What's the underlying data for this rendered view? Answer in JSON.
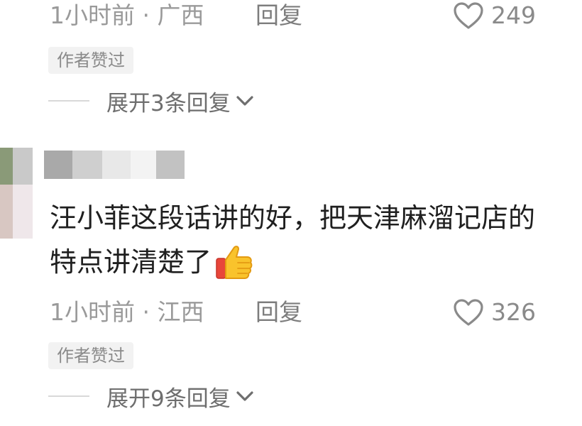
{
  "comment_top": {
    "time": "1小时前 · 广西",
    "reply": "回复",
    "likes": "249",
    "badge": "作者赞过",
    "expand": "展开3条回复"
  },
  "comment_main": {
    "text_line1": "汪小菲这段话讲的好，把天津麻溜记店的",
    "text_line2": "特点讲清楚了",
    "emoji": "thumbs-up",
    "time": "1小时前 · 江西",
    "reply": "回复",
    "likes": "326",
    "badge": "作者赞过",
    "expand": "展开9条回复"
  },
  "colors": {
    "meta_text": "#9a9a9a",
    "body_text": "#1f1f1f",
    "badge_bg": "#f2f2f2"
  },
  "icons": {
    "like": "heart-outline-icon",
    "expand": "chevron-down-icon",
    "emoji": "thumbs-up-emoji"
  }
}
